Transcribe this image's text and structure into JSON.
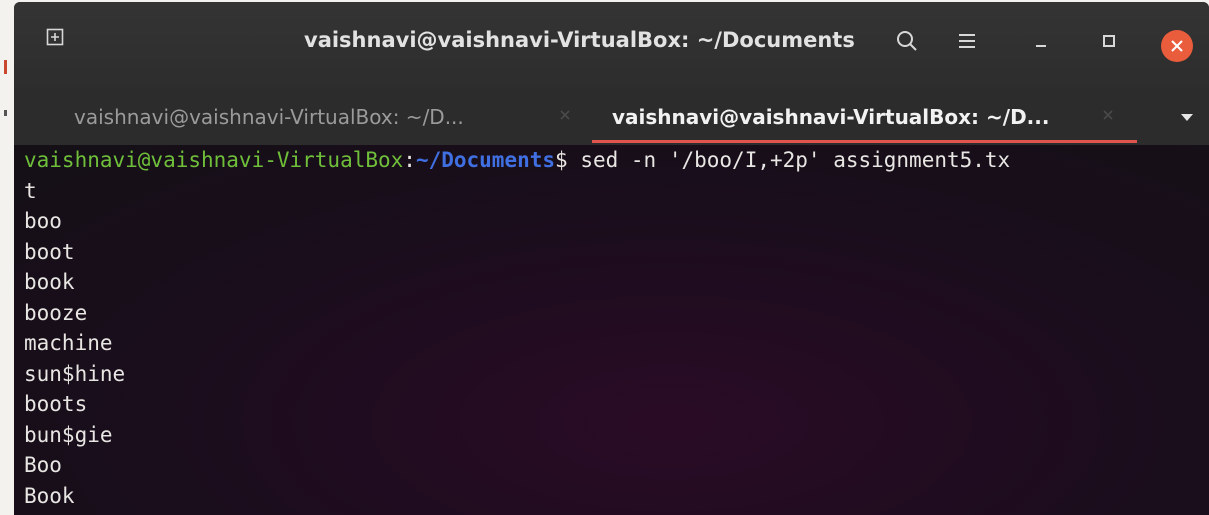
{
  "titlebar": {
    "title": "vaishnavi@vaishnavi-VirtualBox: ~/Documents"
  },
  "tabs": [
    {
      "label": "vaishnavi@vaishnavi-VirtualBox: ~/D...",
      "active": false
    },
    {
      "label": "vaishnavi@vaishnavi-VirtualBox: ~/D...",
      "active": true
    }
  ],
  "terminal": {
    "prompt_user": "vaishnavi@vaishnavi-VirtualBox",
    "prompt_colon": ":",
    "prompt_path": "~/Documents",
    "prompt_symbol": "$ ",
    "command_part1": "sed -n '/boo/I,+2p' assignment5.tx",
    "command_part2": "t",
    "output": [
      "boo",
      "boot",
      "book",
      "booze",
      "machine",
      "sun$hine",
      "boots",
      "bun$gie",
      "Boo",
      "Book"
    ]
  },
  "icons": {
    "new_tab": "new-tab-icon",
    "search": "search-icon",
    "menu": "hamburger-menu-icon",
    "minimize": "minimize-icon",
    "maximize": "maximize-icon",
    "close": "close-icon",
    "tab_menu": "chevron-down-icon"
  },
  "colors": {
    "prompt_user": "#6fbf3a",
    "prompt_path": "#3f6fe0",
    "close_button": "#e95c3c",
    "active_tab_underline": "#e05450"
  }
}
